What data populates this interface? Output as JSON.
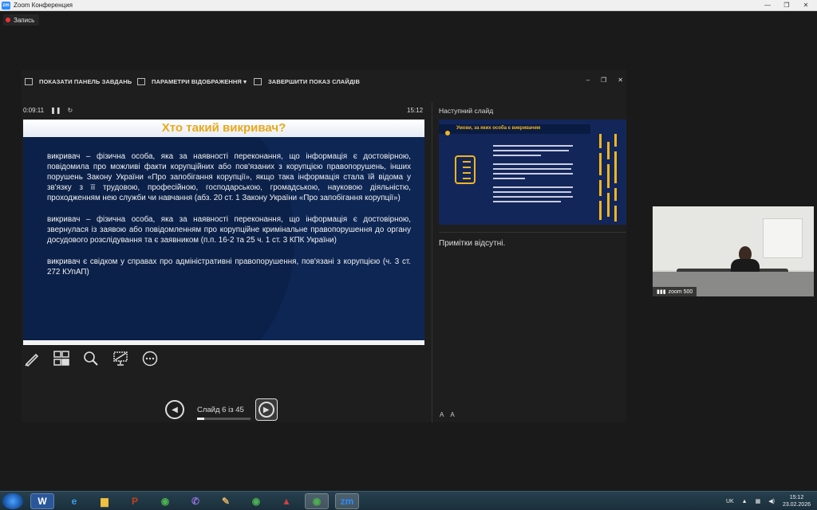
{
  "window": {
    "title": "Zoom Конференция"
  },
  "recording": {
    "label": "Запись"
  },
  "toolbar": {
    "show_taskbar": "ПОКАЗАТИ ПАНЕЛЬ ЗАВДАНЬ",
    "display_settings": "ПАРАМЕТРИ ВІДОБРАЖЕННЯ ▾",
    "end_show": "ЗАВЕРШИТИ ПОКАЗ СЛАЙДІВ"
  },
  "timer": {
    "elapsed": "0:09:11",
    "clock": "15:12"
  },
  "slide": {
    "title": "Хто такий викривач?",
    "paragraphs": [
      "викривач – фізична особа, яка за наявності переконання, що інформація є достовірною, повідомила про можливі факти корупційних або пов'язаних з корупцією правопорушень, інших порушень Закону України «Про запобігання корупції», якщо така інформація стала їй відома у зв'язку з її трудовою, професійною, господарською, громадською, науковою діяльністю, проходженням нею служби чи навчання (абз. 20 ст. 1 Закону України «Про запобігання корупції»)",
      "викривач – фізична особа, яка за наявності переконання, що інформація є достовірною, звернулася із заявою або повідомленням про корупційне кримінальне правопорушення до органу досудового розслідування та є заявником (п.п. 16-2 та 25 ч. 1 ст. 3 КПК України)",
      "викривач є свідком у справах про адміністративні правопорушення, пов'язані з корупцією (ч. 3 ст. 272 КУпАП)"
    ]
  },
  "navigation": {
    "slide_counter": "Слайд 6 із 45",
    "progress_fraction": 0.133
  },
  "next_slide": {
    "label": "Наступний слайд",
    "title": "Умови, за яких особа є викривачем"
  },
  "notes": {
    "text": "Примітки відсутні."
  },
  "font_controls": {
    "increase": "A",
    "decrease": "A"
  },
  "participant": {
    "name": "zoom 500"
  },
  "taskbar": {
    "tray_lang": "UK",
    "time": "15:12",
    "date": "23.02.2026"
  }
}
